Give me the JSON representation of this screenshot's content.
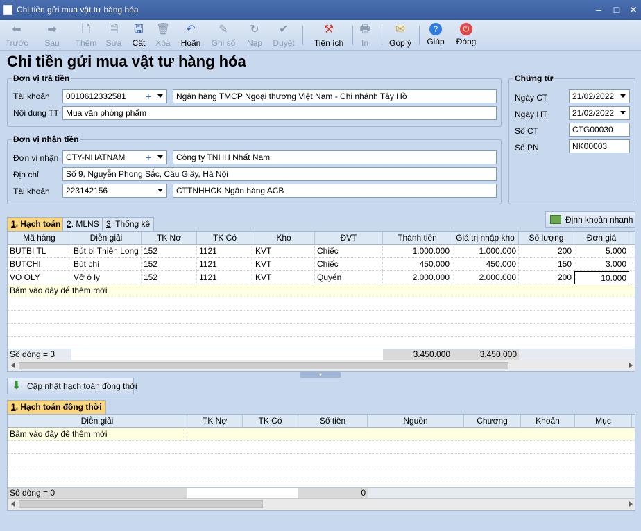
{
  "window": {
    "title": "Chi tiền gửi mua vật tư hàng hóa"
  },
  "toolbar": [
    {
      "label": "Trước",
      "icon": "arrow-left-icon",
      "enabled": false
    },
    {
      "label": "Sau",
      "icon": "arrow-right-icon",
      "enabled": false
    },
    {
      "label": "Thêm",
      "icon": "new-document-icon",
      "enabled": false
    },
    {
      "label": "Sửa",
      "icon": "edit-document-icon",
      "enabled": false
    },
    {
      "label": "Cất",
      "icon": "save-icon",
      "enabled": true
    },
    {
      "label": "Xóa",
      "icon": "delete-document-icon",
      "enabled": false
    },
    {
      "label": "Hoãn",
      "icon": "undo-icon",
      "enabled": true
    },
    {
      "label": "Ghi sổ",
      "icon": "pencil-icon",
      "enabled": false
    },
    {
      "label": "Nạp",
      "icon": "refresh-icon",
      "enabled": false
    },
    {
      "label": "Duyệt",
      "icon": "checkmark-icon",
      "enabled": false
    },
    {
      "label": "Tiện ích",
      "icon": "tools-icon",
      "enabled": true
    },
    {
      "label": "In",
      "icon": "printer-icon",
      "enabled": false
    },
    {
      "label": "Góp ý",
      "icon": "feedback-icon",
      "enabled": true
    },
    {
      "label": "Giúp",
      "icon": "help-icon",
      "enabled": true
    },
    {
      "label": "Đóng",
      "icon": "power-icon",
      "enabled": true
    }
  ],
  "heading": "Chi tiền gửi mua vật tư hàng hóa",
  "payer": {
    "legend": "Đơn vị trả tiền",
    "account_label": "Tài khoản",
    "account_value": "0010612332581",
    "bank_name": "Ngân hàng TMCP Ngoại thương Việt Nam - Chi nhánh Tây Hồ",
    "content_label": "Nội dung TT",
    "content_value": "Mua văn phòng phẩm"
  },
  "payee": {
    "legend": "Đơn vị nhận tiền",
    "unit_label": "Đơn vị nhận",
    "unit_value": "CTY-NHATNAM",
    "unit_name": "Công ty TNHH Nhất Nam",
    "address_label": "Địa chỉ",
    "address_value": "Số 9, Nguyễn Phong Sắc, Cầu Giấy, Hà Nội",
    "account_label": "Tài khoản",
    "account_value": "223142156",
    "account_name": "CTTNHHCK Ngân hàng ACB"
  },
  "voucher": {
    "legend": "Chứng từ",
    "date_ct_label": "Ngày CT",
    "date_ct_value": "21/02/2022",
    "date_ht_label": "Ngày HT",
    "date_ht_value": "21/02/2022",
    "so_ct_label": "Số CT",
    "so_ct_value": "CTG00030",
    "so_pn_label": "Số PN",
    "so_pn_value": "NK00003"
  },
  "quick_entry_button": "Định khoản nhanh",
  "tabs": [
    {
      "num": "1",
      "label": ". Hạch toán",
      "active": true
    },
    {
      "num": "2",
      "label": ". MLNS",
      "active": false
    },
    {
      "num": "3",
      "label": ". Thống kê",
      "active": false
    }
  ],
  "main_grid": {
    "columns": [
      "Mã hàng",
      "Diễn giải",
      "TK Nợ",
      "TK Có",
      "Kho",
      "ĐVT",
      "Thành tiền",
      "Giá trị nhập kho",
      "Số lượng",
      "Đơn giá"
    ],
    "rows": [
      [
        "BUTBI TL",
        "Bút bi Thiên Long",
        "152",
        "1121",
        "KVT",
        "Chiếc",
        "1.000.000",
        "1.000.000",
        "200",
        "5.000"
      ],
      [
        "BUTCHI",
        "Bút chì",
        "152",
        "1121",
        "KVT",
        "Chiếc",
        "450.000",
        "450.000",
        "150",
        "3.000"
      ],
      [
        "VO OLY",
        "Vở ô ly",
        "152",
        "1121",
        "KVT",
        "Quyển",
        "2.000.000",
        "2.000.000",
        "200",
        "10.000"
      ]
    ],
    "add_row_text": "Bấm vào đây để thêm mới",
    "footer_count": "Số dòng = 3",
    "footer_total_amount": "3.450.000",
    "footer_total_import": "3.450.000"
  },
  "update_button": "Cập nhật hạch toán đồng thời",
  "sub_tab": {
    "num": "1",
    "label": ". Hạch toán đồng thời"
  },
  "sub_grid": {
    "columns": [
      "Diễn giải",
      "TK Nợ",
      "TK Có",
      "Số tiền",
      "Nguồn",
      "Chương",
      "Khoản",
      "Mục"
    ],
    "add_row_text": "Bấm vào đây để thêm mới",
    "footer_count": "Số dòng = 0",
    "footer_total": "0"
  }
}
